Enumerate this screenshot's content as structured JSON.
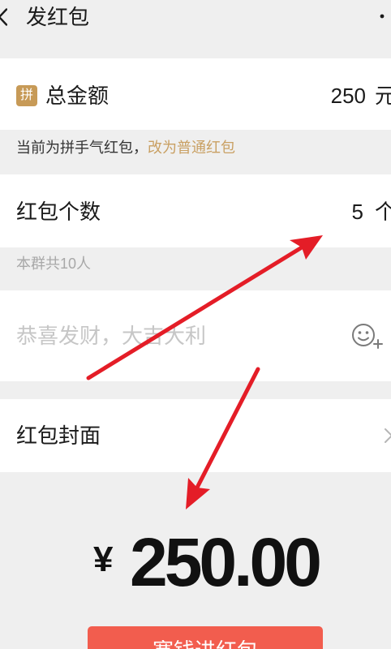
{
  "header": {
    "title": "发红包",
    "back_icon": "chevron-left-icon",
    "more_icon": "more-icon"
  },
  "amount_row": {
    "badge": "拼",
    "label": "总金额",
    "value": "250",
    "unit": "元"
  },
  "mode_hint": {
    "text": "当前为拼手气红包，",
    "link": "改为普通红包"
  },
  "count_row": {
    "label": "红包个数",
    "value": "5",
    "unit": "个"
  },
  "group_hint": {
    "text": "本群共10人"
  },
  "greeting": {
    "placeholder": "恭喜发财，大吉大利",
    "emoji_icon": "emoji-add-icon"
  },
  "cover_row": {
    "label": "红包封面",
    "chevron_icon": "chevron-right-icon"
  },
  "total": {
    "currency": "¥",
    "amount": "250.00"
  },
  "submit_button": {
    "label": "塞钱进红包"
  },
  "colors": {
    "background": "#efefef",
    "card": "#ffffff",
    "text": "#1a1a1a",
    "hint_text": "#333333",
    "muted_text": "#a8a8a8",
    "placeholder": "#c6c6c6",
    "link_gold": "#c9a063",
    "badge": "#c79a57",
    "button": "#f25d4e",
    "annotation_arrow": "#e41d27"
  }
}
